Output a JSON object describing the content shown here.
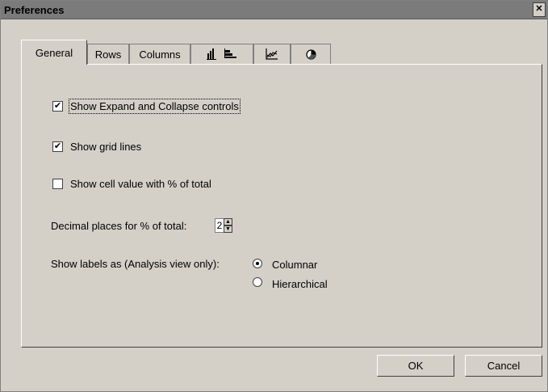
{
  "window": {
    "title": "Preferences",
    "close_glyph": "✕"
  },
  "tabs": [
    {
      "label": "General",
      "active": true
    },
    {
      "label": "Rows"
    },
    {
      "label": "Columns"
    },
    {
      "icon": "bar-chart-icon"
    },
    {
      "icon": "line-chart-icon"
    },
    {
      "icon": "pie-chart-icon"
    }
  ],
  "general": {
    "show_expand_collapse": {
      "label": "Show Expand and Collapse controls",
      "checked": true
    },
    "show_grid_lines": {
      "label": "Show grid lines",
      "checked": true
    },
    "show_percent_total": {
      "label": "Show cell value with % of total",
      "checked": false
    },
    "decimal_places": {
      "label": "Decimal places for % of total:",
      "value": "2"
    },
    "show_labels_as": {
      "label": "Show labels as (Analysis view only):",
      "options": [
        {
          "label": "Columnar",
          "selected": true
        },
        {
          "label": "Hierarchical",
          "selected": false
        }
      ]
    }
  },
  "footer": {
    "ok_label": "OK",
    "cancel_label": "Cancel"
  },
  "colors": {
    "dialog_bg": "#d4d0c8",
    "titlebar_bg": "#7b7b7b"
  }
}
